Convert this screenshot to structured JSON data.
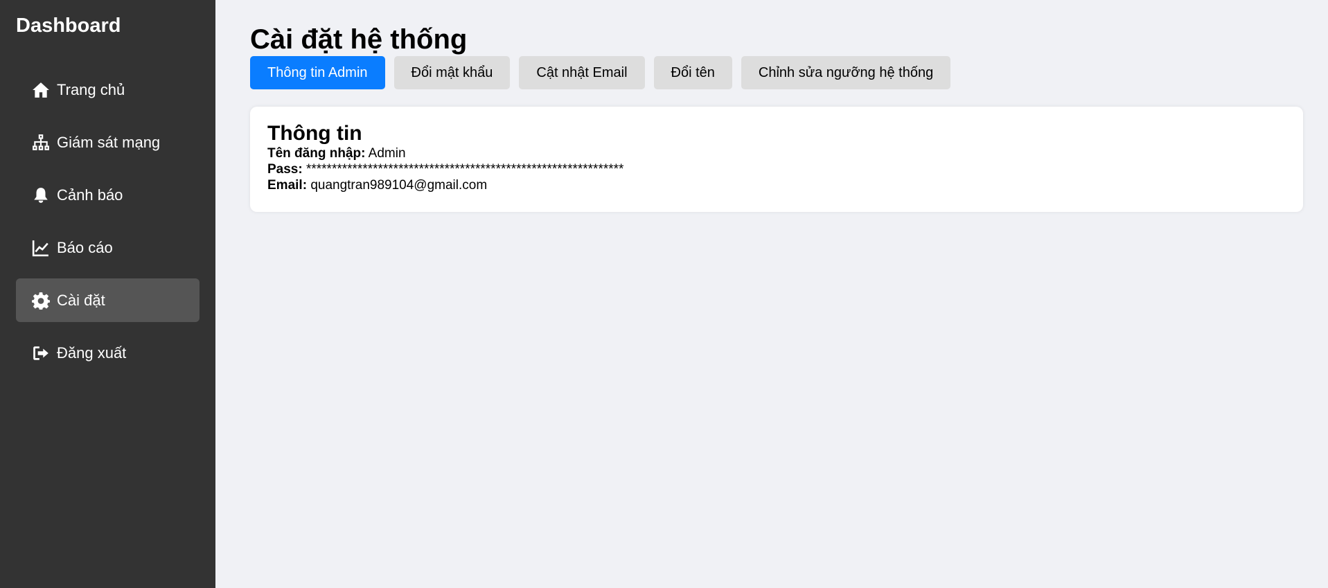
{
  "sidebar": {
    "brand": "Dashboard",
    "items": [
      {
        "label": "Trang chủ",
        "icon": "home-icon"
      },
      {
        "label": "Giám sát mạng",
        "icon": "network-icon"
      },
      {
        "label": "Cảnh báo",
        "icon": "bell-icon"
      },
      {
        "label": "Báo cáo",
        "icon": "chart-line-icon"
      },
      {
        "label": "Cài đặt",
        "icon": "gear-icon",
        "active": true
      },
      {
        "label": "Đăng xuất",
        "icon": "logout-icon"
      }
    ]
  },
  "main": {
    "title": "Cài đặt hệ thống",
    "tabs": [
      {
        "label": "Thông tin Admin",
        "active": true
      },
      {
        "label": "Đổi mật khẩu"
      },
      {
        "label": "Cật nhật Email"
      },
      {
        "label": "Đổi tên"
      },
      {
        "label": "Chỉnh sửa ngưỡng hệ thống"
      }
    ],
    "card": {
      "title": "Thông tin",
      "username_label": "Tên đăng nhập:",
      "username_value": "Admin",
      "pass_label": "Pass:",
      "pass_value": "**************************************************************",
      "email_label": "Email:",
      "email_value": "quangtran989104@gmail.com"
    }
  },
  "colors": {
    "sidebar_bg": "#333333",
    "sidebar_active": "#555555",
    "accent": "#0a7dff",
    "tab_bg": "#dddddd",
    "page_bg": "#f0f1f5"
  }
}
